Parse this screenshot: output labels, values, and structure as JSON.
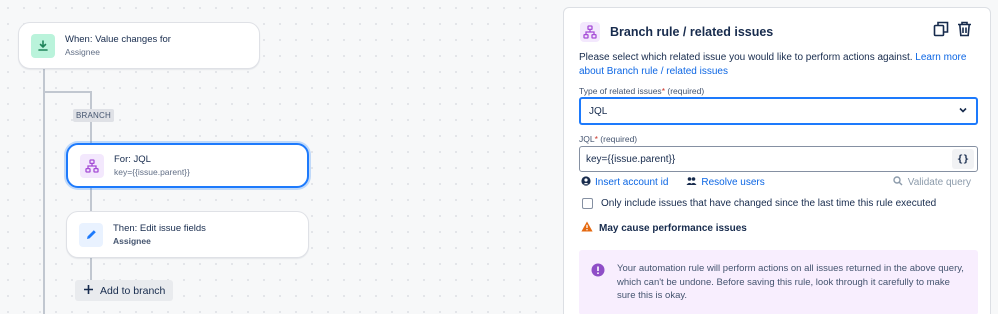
{
  "flow": {
    "trigger": {
      "title": "When: Value changes for",
      "subtitle": "Assignee"
    },
    "branch_tag": "BRANCH",
    "branch_node": {
      "title": "For: JQL",
      "subtitle": "key={{issue.parent}}"
    },
    "action_node": {
      "title": "Then: Edit issue fields",
      "subtitle": "Assignee"
    },
    "add_to_branch_label": "Add to branch"
  },
  "panel": {
    "title": "Branch rule / related issues",
    "description": "Please select which related issue you would like to perform actions against.",
    "learn_more_link": "Learn more about Branch rule / related issues",
    "type_field": {
      "label": "Type of related issues",
      "required_marker": "*",
      "required_text": "(required)",
      "selected_value": "JQL"
    },
    "jql_field": {
      "label": "JQL",
      "required_marker": "*",
      "required_text": "(required)",
      "value": "key={{issue.parent}}",
      "smart_values_button": "{}"
    },
    "insert_account_id": "Insert account id",
    "resolve_users": "Resolve users",
    "validate_query": "Validate query",
    "checkbox_label": "Only include issues that have changed since the last time this rule executed",
    "checkbox_checked": false,
    "warning_text": "May cause performance issues",
    "info_note": "Your automation rule will perform actions on all issues returned in the above query, which can't be undone. Before saving this rule, look through it carefully to make sure this is okay."
  },
  "colors": {
    "accent_blue": "#1d7afc",
    "link_blue": "#0c66e4",
    "trigger_icon_bg": "#dcfff1",
    "branch_icon_color": "#a54bd6",
    "warning_orange": "#e56910",
    "note_bg": "#f8eefe"
  }
}
